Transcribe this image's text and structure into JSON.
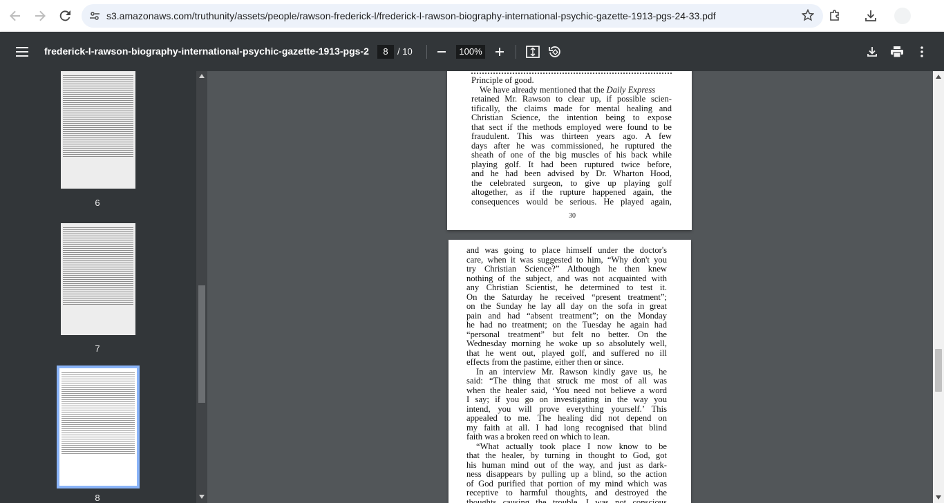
{
  "browser": {
    "url": "s3.amazonaws.com/truthunity/assets/people/rawson-frederick-l/frederick-l-rawson-biography-international-psychic-gazette-1913-pgs-24-33.pdf"
  },
  "toolbar": {
    "title": "frederick-l-rawson-biography-international-psychic-gazette-1913-pgs-2...",
    "current_page": "8",
    "total_pages": "/ 10",
    "zoom": "100%"
  },
  "sidebar": {
    "thumbnails": [
      {
        "label": "6"
      },
      {
        "label": "7"
      },
      {
        "label": "8"
      }
    ]
  },
  "page7_bottom": {
    "top_fragment": "Principle of good.",
    "paragraph_pre": "We have already mentioned that the ",
    "paragraph_italic": "Daily Express",
    "lines": [
      "retained Mr. Rawson to clear up, if possible scien-",
      "tifically, the claims made for mental healing and",
      "Christian Science, the intention being to expose",
      "that sect if the methods employed were found to be",
      "fraudulent.  This was thirteen years ago.  A few",
      "days after he was commissioned, he ruptured the",
      "sheath of one of the big muscles of his back while",
      "playing golf.  It had been ruptured twice before,",
      "and he had been advised by Dr. Wharton Hood,",
      "the celebrated surgeon, to give up playing golf",
      "altogether, as if the rupture happened again, the",
      "consequences would be serious.  He played again,"
    ],
    "page_number": "30"
  },
  "page8": {
    "lines": [
      "and was going to place himself under the doctor's",
      "care, when it was suggested to him, “Why don't you",
      "try Christian Science?”  Although he then knew",
      "nothing of the subject, and was not acquainted with",
      "any Christian Scientist, he determined to test it.",
      "On the Saturday he received “present treatment”;",
      "on the Sunday he lay all day on the sofa in great",
      "pain and had “absent treatment”; on the Monday",
      "he had no treatment; on the Tuesday he again had",
      "“personal treatment” but felt no better.  On the",
      "Wednesday morning he woke up so absolutely well,",
      "that he went out, played golf, and suffered no ill",
      "effects from the pastime, either then or since."
    ],
    "lines2": [
      "In an interview Mr. Rawson kindly gave us, he",
      "said: “The thing that struck me most of all was",
      "when the healer said, ‘You need not believe a word",
      "I say; if you go on investigating in the way you",
      "intend, you will prove everything yourself.’  This",
      "appealed to me.  The healing did not depend on",
      "my faith at all.  I had long recognised that blind",
      "faith was a broken reed on which to lean."
    ],
    "lines3": [
      "“What actually took place I now know to be",
      "that the healer, by turning in thought to God, got",
      "his human mind out of the way, and just as dark-",
      "ness disappears by pulling up a blind, so the action",
      "of God purified that portion of my mind which was",
      "receptive to harmful thoughts, and destroyed the",
      "thoughts causing the trouble.  I was not conscious"
    ]
  },
  "icons": [
    "back-icon",
    "forward-icon",
    "reload-icon",
    "site-info-icon",
    "star-icon",
    "extensions-icon",
    "download-icon",
    "menu-icon",
    "minus-icon",
    "plus-icon",
    "fit-page-icon",
    "rotate-icon",
    "print-icon",
    "more-icon"
  ]
}
